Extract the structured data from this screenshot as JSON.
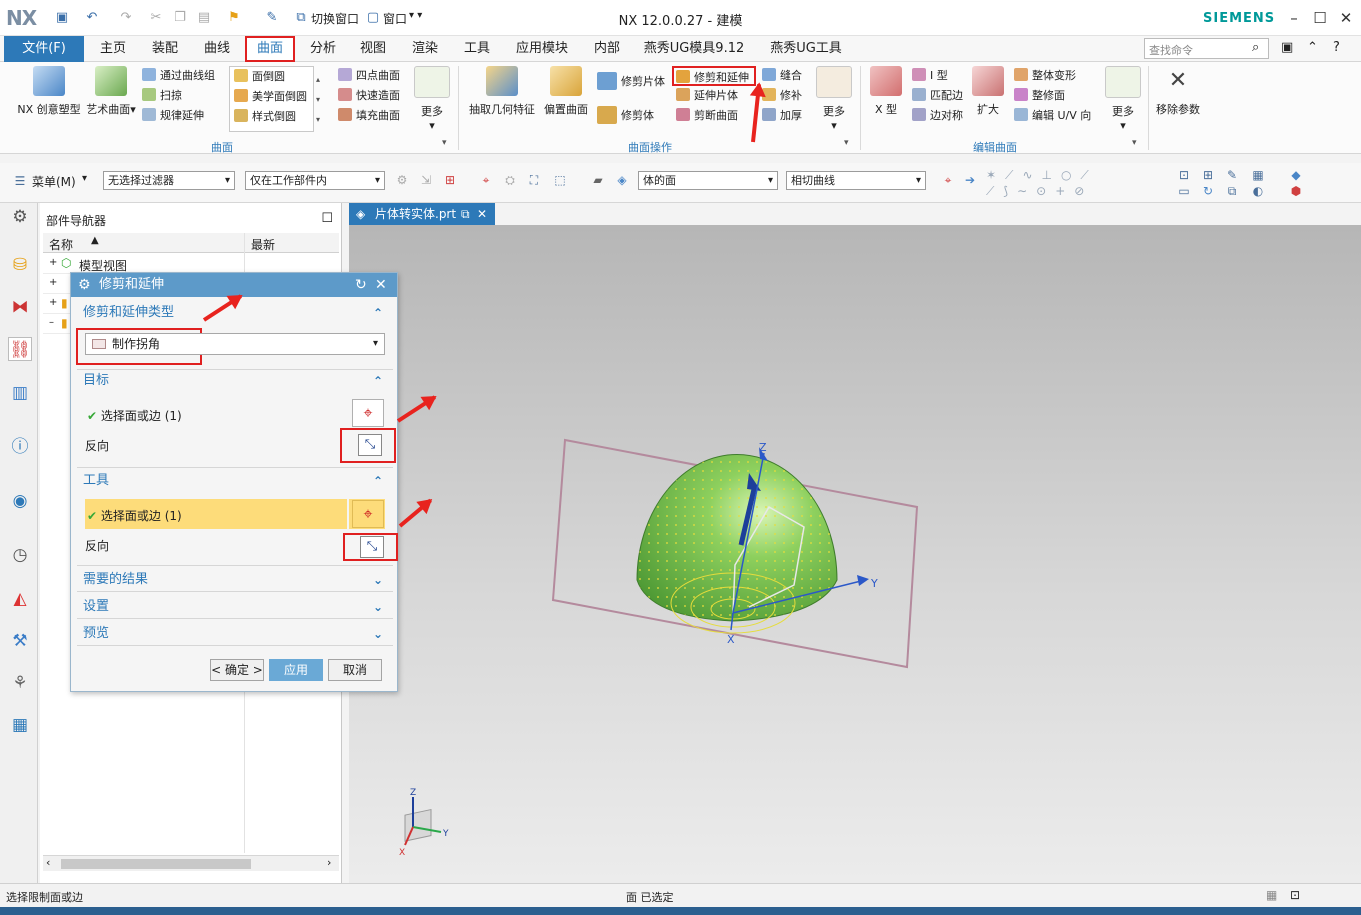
{
  "titlebar": {
    "logo": "NX",
    "title": "NX 12.0.0.27 - 建模",
    "brand": "SIEMENS",
    "switch_window": "切换窗口",
    "window": "窗口"
  },
  "menu": {
    "file": "文件(F)",
    "tabs": [
      "主页",
      "装配",
      "曲线",
      "曲面",
      "分析",
      "视图",
      "渲染",
      "工具",
      "应用模块",
      "内部",
      "燕秀UG模具9.12",
      "燕秀UG工具"
    ],
    "active_tab": "曲面",
    "search_placeholder": "查找命令"
  },
  "ribbon": {
    "group1": {
      "label": "曲面",
      "big": [
        "NX 创意塑型",
        "艺术曲面"
      ],
      "col1": [
        "通过曲线组",
        "扫掠",
        "规律延伸"
      ],
      "col2": [
        "面倒圆",
        "美学面倒圆",
        "样式倒圆"
      ],
      "col3": [
        "四点曲面",
        "快速造面",
        "填充曲面"
      ],
      "more": "更多"
    },
    "group2": {
      "label": "曲面操作",
      "big": [
        "抽取几何特征",
        "偏置曲面"
      ],
      "col1": [
        "修剪片体",
        "修剪体"
      ],
      "col2": [
        "修剪和延伸",
        "延伸片体",
        "剪断曲面"
      ],
      "col3": [
        "缝合",
        "修补",
        "加厚"
      ],
      "more": "更多"
    },
    "group3": {
      "label": "编辑曲面",
      "big": [
        "X 型",
        "扩大"
      ],
      "col1": [
        "I 型",
        "匹配边",
        "边对称"
      ],
      "col2": [
        "整体变形",
        "整修面",
        "编辑 U/V 向"
      ],
      "more": "更多",
      "remove": "移除参数"
    }
  },
  "toolbar": {
    "menu": "菜单(M)",
    "filter": "无选择过滤器",
    "scope": "仅在工作部件内",
    "face_rule": "体的面",
    "curve_rule": "相切曲线"
  },
  "navigator": {
    "title": "部件导航器",
    "col_name": "名称",
    "col_latest": "最新",
    "item1": "模型视图"
  },
  "viewport": {
    "tab": "片体转实体.prt",
    "axis_z": "Z",
    "axis_y": "Y",
    "axis_x": "X"
  },
  "dialog": {
    "title": "修剪和延伸",
    "type_section": "修剪和延伸类型",
    "type_value": "制作拐角",
    "target_section": "目标",
    "target_select": "选择面或边 (1)",
    "target_reverse": "反向",
    "tool_section": "工具",
    "tool_select": "选择面或边 (1)",
    "tool_reverse": "反向",
    "results_section": "需要的结果",
    "settings_section": "设置",
    "preview_section": "预览",
    "ok": "< 确定 >",
    "apply": "应用",
    "cancel": "取消"
  },
  "status": {
    "left": "选择限制面或边",
    "center": "面 已选定"
  },
  "colors": {
    "accent": "#2d79b8",
    "highlight_row": "#fddc7a",
    "callout": "#e8231e",
    "sphere": "#7cc254"
  }
}
